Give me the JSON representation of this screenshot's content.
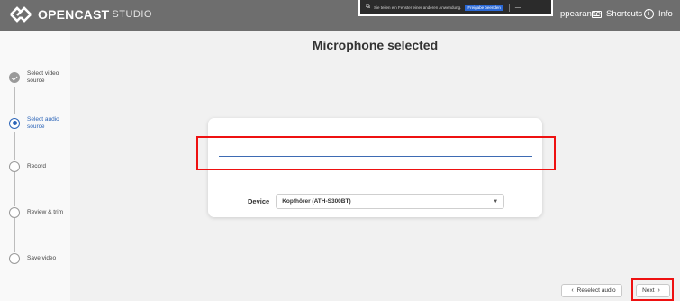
{
  "header": {
    "brand": "OPENCAST",
    "brand_sub": "STUDIO",
    "nav": {
      "appearance_label": "ppearance",
      "shortcuts_label": "Shortcuts",
      "info_label": "Info"
    }
  },
  "share_bar": {
    "message": "Sie teilen ein Fenster einer anderen Anwendung.",
    "share_button": "Freigabe beenden",
    "minimize": "—"
  },
  "sidebar": {
    "steps": [
      {
        "label": "Select video source",
        "state": "done"
      },
      {
        "label": "Select audio source",
        "state": "active"
      },
      {
        "label": "Record",
        "state": "pending"
      },
      {
        "label": "Review & trim",
        "state": "pending"
      },
      {
        "label": "Save video",
        "state": "pending"
      }
    ]
  },
  "main": {
    "title": "Microphone selected",
    "device_label": "Device",
    "device_value": "Kopfhörer (ATH-S300BT)"
  },
  "buttons": {
    "reselect": "Reselect audio",
    "next": "Next"
  },
  "colors": {
    "accent": "#2b64b8",
    "highlight": "#e11111",
    "topbar": "#6e6e6e"
  }
}
